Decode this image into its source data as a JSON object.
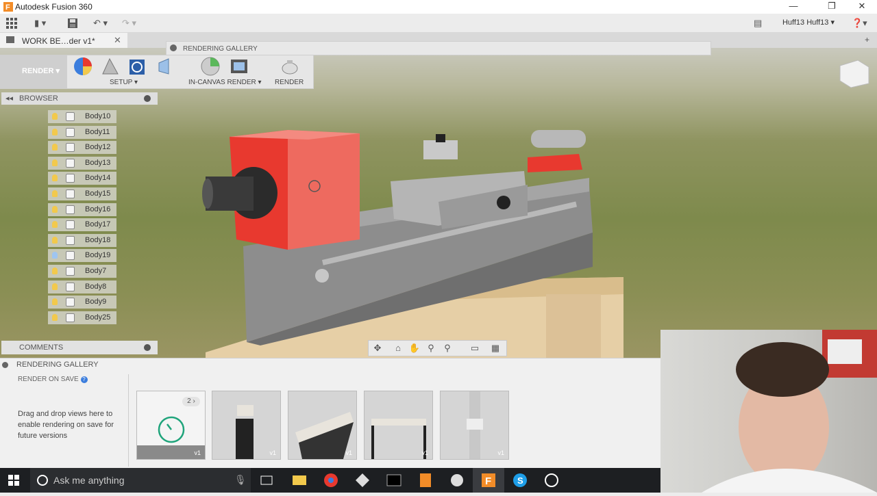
{
  "window": {
    "title": "Autodesk Fusion 360"
  },
  "toolbar": {
    "user": "Huff13 Huff13"
  },
  "document_tab": {
    "label": "WORK BE…der v1*"
  },
  "workspace": {
    "label": "RENDER"
  },
  "ribbon": {
    "setup_label": "SETUP",
    "in_canvas_label": "IN-CANVAS RENDER",
    "render_label": "RENDER"
  },
  "rendering_gallery_strip": {
    "label": "RENDERING GALLERY"
  },
  "browser": {
    "title": "BROWSER",
    "items": [
      {
        "label": "Body10",
        "bulb": "#f2c94c"
      },
      {
        "label": "Body11",
        "bulb": "#f2c94c"
      },
      {
        "label": "Body12",
        "bulb": "#f2c94c"
      },
      {
        "label": "Body13",
        "bulb": "#f2c94c"
      },
      {
        "label": "Body14",
        "bulb": "#f2c94c"
      },
      {
        "label": "Body15",
        "bulb": "#f2c94c"
      },
      {
        "label": "Body16",
        "bulb": "#f2c94c"
      },
      {
        "label": "Body17",
        "bulb": "#f2c94c"
      },
      {
        "label": "Body18",
        "bulb": "#f2c94c"
      },
      {
        "label": "Body19",
        "bulb": "#9fc5f0"
      },
      {
        "label": "Body7",
        "bulb": "#f2c94c"
      },
      {
        "label": "Body8",
        "bulb": "#f2c94c"
      },
      {
        "label": "Body9",
        "bulb": "#f2c94c"
      },
      {
        "label": "Body25",
        "bulb": "#f2c94c"
      }
    ]
  },
  "comments": {
    "title": "COMMENTS"
  },
  "gallery": {
    "title": "RENDERING GALLERY",
    "render_on_save": "RENDER ON SAVE",
    "drag_text": "Drag and drop views here to enable rendering on save for future versions",
    "queue_count": "2",
    "thumbs": [
      {
        "version": "v1"
      },
      {
        "version": "v1"
      },
      {
        "version": "v1"
      },
      {
        "version": "v1"
      },
      {
        "version": "v1"
      }
    ]
  },
  "taskbar": {
    "search_placeholder": "Ask me anything"
  },
  "colors": {
    "accent_red": "#e8392f",
    "taskbar": "#1d1f22"
  }
}
